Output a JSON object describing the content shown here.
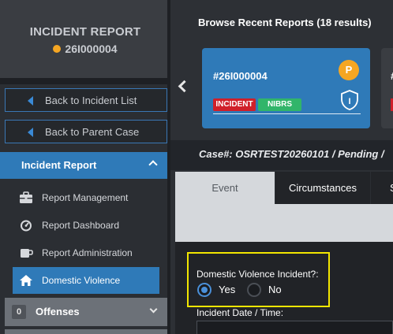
{
  "sidebar": {
    "title": "INCIDENT REPORT",
    "incident_number": "26I000004",
    "status_dot_color": "#f5a623",
    "back_to_list": "Back to Incident List",
    "back_to_parent": "Back to Parent Case",
    "section": "Incident Report",
    "items": [
      {
        "label": "Report Management",
        "icon": "briefcase-icon"
      },
      {
        "label": "Report Dashboard",
        "icon": "speedometer-icon"
      },
      {
        "label": "Report Administration",
        "icon": "mug-icon"
      },
      {
        "label": "Domestic Violence",
        "icon": "house-icon",
        "active": true
      }
    ],
    "offenses": {
      "count": "0",
      "label": "Offenses"
    }
  },
  "browse": {
    "title": "Browse Recent Reports (18 results)",
    "cards": [
      {
        "number": "#26I000004",
        "badge": "P",
        "tags": [
          "INCIDENT",
          "NIBRS"
        ],
        "shield_label": "I"
      },
      {
        "number": "#"
      }
    ]
  },
  "case_bar": {
    "text": "Case#: OSRTEST20260101 / Pending /"
  },
  "tabs": [
    {
      "label": "Event",
      "active": true
    },
    {
      "label": "Circumstances"
    },
    {
      "label": "S"
    }
  ],
  "form": {
    "dv_label": "Domestic Violence Incident?:",
    "yes_label": "Yes",
    "no_label": "No",
    "dv_value": "Yes",
    "date_label": "Incident Date / Time:"
  },
  "colors": {
    "accent": "#2f7ab8",
    "highlight": "#f2e600",
    "incident_tag": "#d0202a",
    "nibrs_tag": "#31b56a"
  }
}
